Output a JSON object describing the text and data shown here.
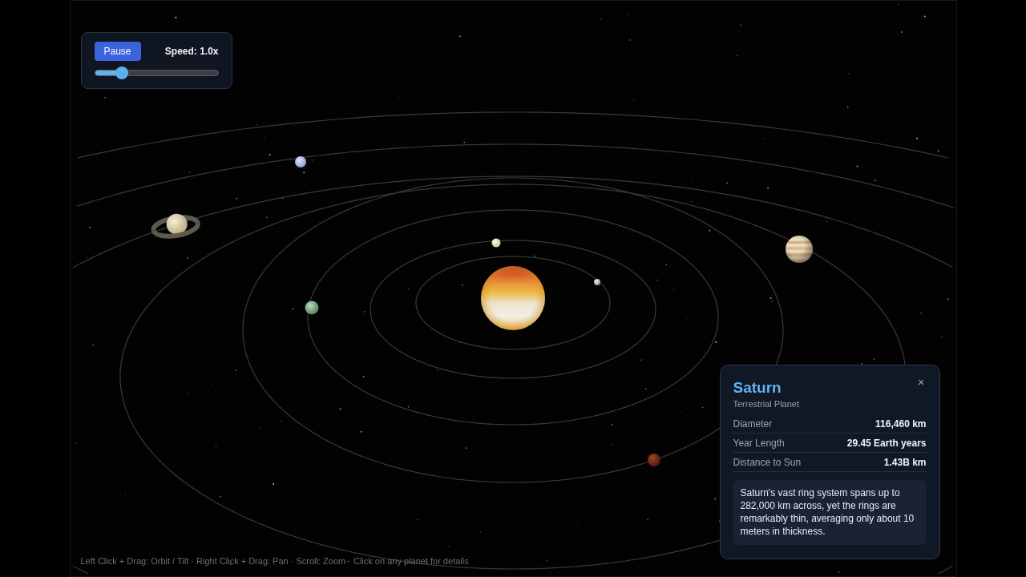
{
  "controls": {
    "pause_button": "Pause",
    "speed_label": "Speed: 1.0x",
    "speed_slider": {
      "level": 0.22
    }
  },
  "info_panel": {
    "title": "Saturn",
    "subtitle": "Terrestrial Planet",
    "close_button": "×",
    "stats": [
      {
        "label": "Diameter",
        "value": "116,460 km"
      },
      {
        "label": "Year Length",
        "value": "29.45 Earth years"
      },
      {
        "label": "Distance to Sun",
        "value": "1.43B km"
      }
    ],
    "fact": "Saturn's vast ring system spans up to 282,000 km across, yet the rings are remarkably thin, averaging only about 10 meters in thickness."
  },
  "hint_bar": "Left Click + Drag: Orbit / Tilt · Right Click + Drag: Pan · Scroll: Zoom · Click on any planet for details"
}
